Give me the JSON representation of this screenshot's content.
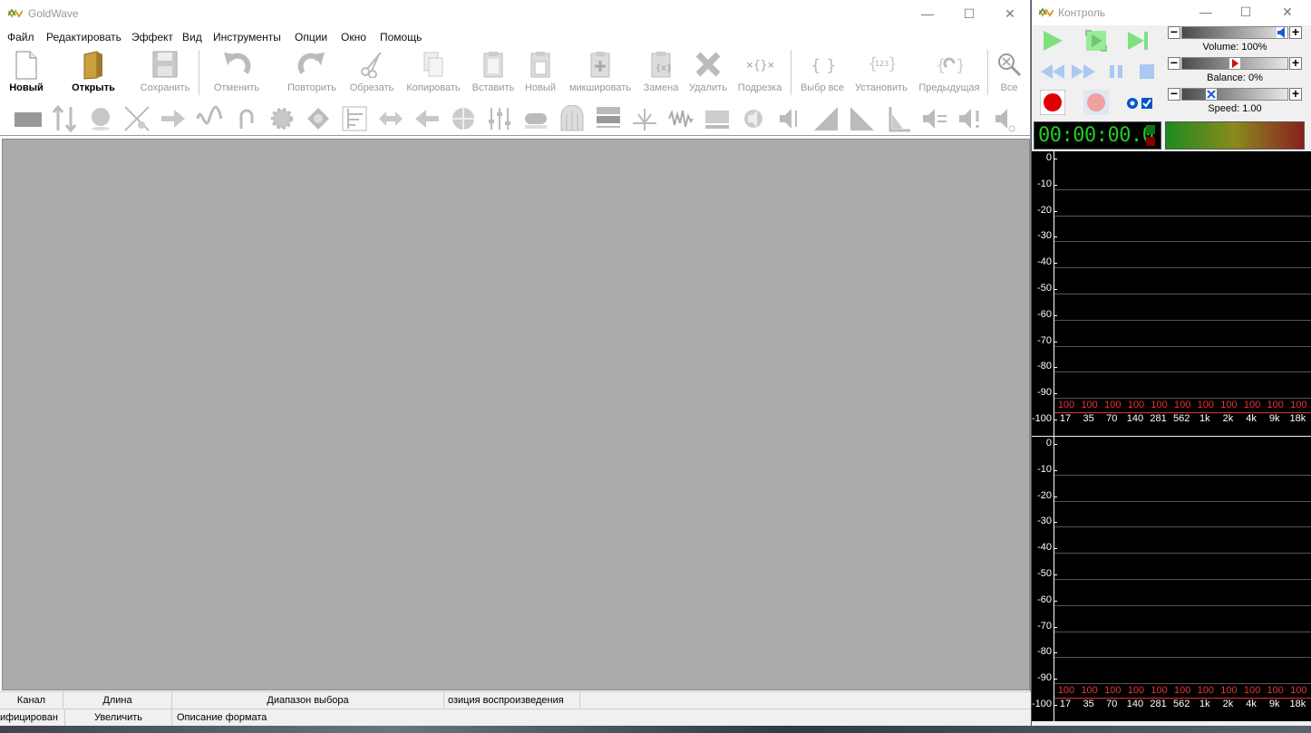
{
  "main": {
    "title": "GoldWave",
    "menu": [
      "Файл",
      "Редактировать",
      "Эффект",
      "Вид",
      "Инструменты",
      "Опции",
      "Окно",
      "Помощь"
    ],
    "toolbar": {
      "new": "Новый",
      "open": "Открыть",
      "save": "Сохранить",
      "undo": "Отменить",
      "redo": "Повторить",
      "trim": "Обрезать",
      "copy": "Копировать",
      "paste": "Вставить",
      "paste_new": "Новый",
      "mix": "микшировать",
      "replace": "Замена",
      "delete": "Удалить",
      "crop": "Подрезка",
      "select_all": "Выбр все",
      "set": "Установить",
      "previous": "Предыдущая",
      "all": "Все"
    },
    "status1": {
      "channel": "Канал",
      "length": "Длина",
      "selection": "Диапазон выбора",
      "playpos": "озиция воспроизведения"
    },
    "status2": {
      "modified": "ифицирован",
      "zoom": "Увеличить",
      "format": "Описание формата"
    }
  },
  "control": {
    "title": "Контроль",
    "volume": "Volume: 100%",
    "balance": "Balance: 0%",
    "speed": "Speed: 1.00",
    "time": "00:00:00.0",
    "volume_level": 1.0,
    "balance_level": 0.5,
    "speed_level": 0.25,
    "spectrum": {
      "y_labels": [
        "0",
        "-10",
        "-20",
        "-30",
        "-40",
        "-50",
        "-60",
        "-70",
        "-80",
        "-90",
        "-100"
      ],
      "freq_labels": [
        "17",
        "35",
        "70",
        "140",
        "281",
        "562",
        "1k",
        "2k",
        "4k",
        "9k",
        "18k"
      ],
      "band_values": [
        "100",
        "100",
        "100",
        "100",
        "100",
        "100",
        "100",
        "100",
        "100",
        "100",
        "100"
      ]
    }
  },
  "colors": {
    "accent_gold": "#d8a020",
    "play_green": "#2fc02f",
    "record_red": "#e00000",
    "time_green": "#22cc22",
    "band_red": "#e33333"
  }
}
